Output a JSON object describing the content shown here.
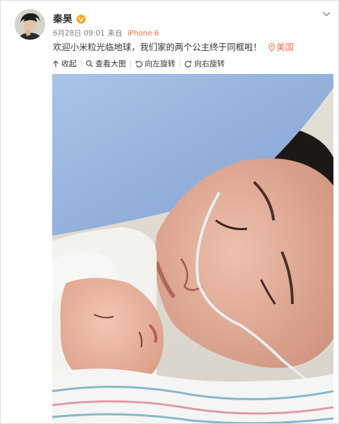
{
  "post": {
    "username": "秦昊",
    "date": "6月28日 09:01",
    "source_prefix": "来自",
    "device": "iPhone 6",
    "text": "欢迎小米粒光临地球，我们家的两个公主终于同框啦！",
    "location": "美国"
  },
  "toolbar": [
    {
      "label": "收起",
      "icon": "collapse-up-icon"
    },
    {
      "label": "查看大图",
      "icon": "magnify-icon"
    },
    {
      "label": "向左旋转",
      "icon": "rotate-left-icon"
    },
    {
      "label": "向右旋转",
      "icon": "rotate-right-icon"
    }
  ],
  "colors": {
    "accent": "#eb7350",
    "verified": "#f5a623",
    "text": "#333333",
    "meta": "#808080"
  }
}
